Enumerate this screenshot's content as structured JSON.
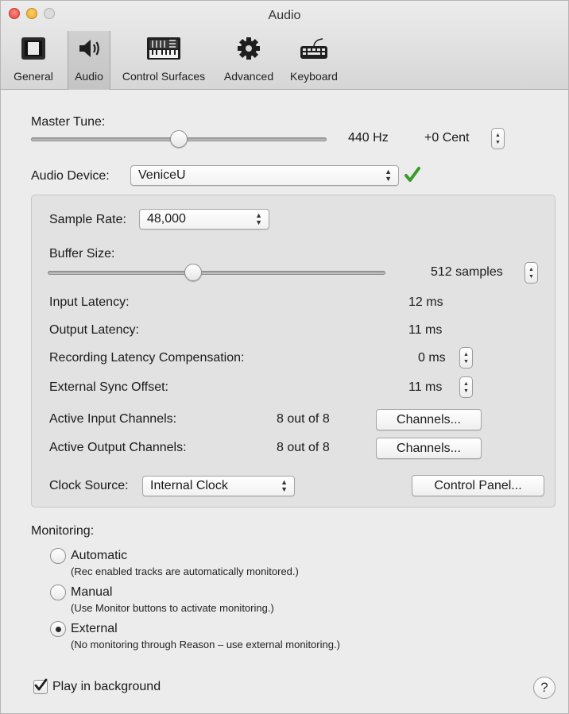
{
  "window": {
    "title": "Audio"
  },
  "toolbar": {
    "items": [
      {
        "label": "General",
        "icon": "general-icon"
      },
      {
        "label": "Audio",
        "icon": "speaker-icon",
        "selected": true
      },
      {
        "label": "Control Surfaces",
        "icon": "mixer-icon"
      },
      {
        "label": "Advanced",
        "icon": "gear-icon"
      },
      {
        "label": "Keyboard",
        "icon": "keyboard-icon"
      }
    ]
  },
  "master_tune": {
    "label": "Master Tune:",
    "hz": "440 Hz",
    "cent": "+0 Cent"
  },
  "audio_device": {
    "label": "Audio Device:",
    "value": "VeniceU",
    "status_color": "#3a9a2a"
  },
  "sample_rate": {
    "label": "Sample Rate:",
    "value": "48,000"
  },
  "buffer_size": {
    "label": "Buffer Size:",
    "value": "512 samples"
  },
  "latency": {
    "input_label": "Input Latency:",
    "input_value": "12 ms",
    "output_label": "Output Latency:",
    "output_value": "11 ms",
    "rec_comp_label": "Recording Latency Compensation:",
    "rec_comp_value": "0 ms",
    "ext_sync_label": "External Sync Offset:",
    "ext_sync_value": "11 ms"
  },
  "channels": {
    "input_label": "Active Input Channels:",
    "input_value": "8 out of 8",
    "output_label": "Active Output Channels:",
    "output_value": "8 out of 8",
    "button_label": "Channels..."
  },
  "clock": {
    "label": "Clock Source:",
    "value": "Internal Clock",
    "control_panel_label": "Control Panel..."
  },
  "monitoring": {
    "label": "Monitoring:",
    "options": [
      {
        "title": "Automatic",
        "desc": "(Rec enabled tracks are automatically monitored.)",
        "checked": false
      },
      {
        "title": "Manual",
        "desc": "(Use Monitor buttons to activate monitoring.)",
        "checked": false
      },
      {
        "title": "External",
        "desc": "(No monitoring through Reason – use external monitoring.)",
        "checked": true
      }
    ]
  },
  "play_in_background": {
    "label": "Play in background",
    "checked": true
  },
  "help": {
    "label": "?"
  }
}
